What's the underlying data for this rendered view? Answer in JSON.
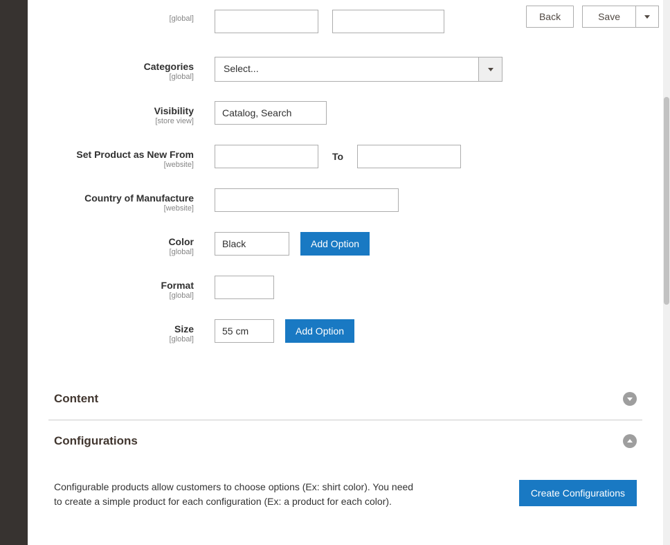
{
  "header": {
    "back": "Back",
    "save": "Save"
  },
  "fields": {
    "hidden_top": {
      "label": "",
      "scope": "[global]"
    },
    "categories": {
      "label": "Categories",
      "scope": "[global]",
      "placeholder": "Select..."
    },
    "visibility": {
      "label": "Visibility",
      "scope": "[store view]",
      "value": "Catalog, Search"
    },
    "new_from": {
      "label": "Set Product as New From",
      "scope": "[website]",
      "to": "To"
    },
    "country": {
      "label": "Country of Manufacture",
      "scope": "[website]"
    },
    "color": {
      "label": "Color",
      "scope": "[global]",
      "value": "Black",
      "add": "Add Option"
    },
    "format": {
      "label": "Format",
      "scope": "[global]"
    },
    "size": {
      "label": "Size",
      "scope": "[global]",
      "value": "55 cm",
      "add": "Add Option"
    }
  },
  "sections": {
    "content": {
      "title": "Content"
    },
    "configurations": {
      "title": "Configurations",
      "desc": "Configurable products allow customers to choose options (Ex: shirt color). You need to create a simple product for each configuration (Ex: a product for each color).",
      "create": "Create Configurations"
    }
  }
}
